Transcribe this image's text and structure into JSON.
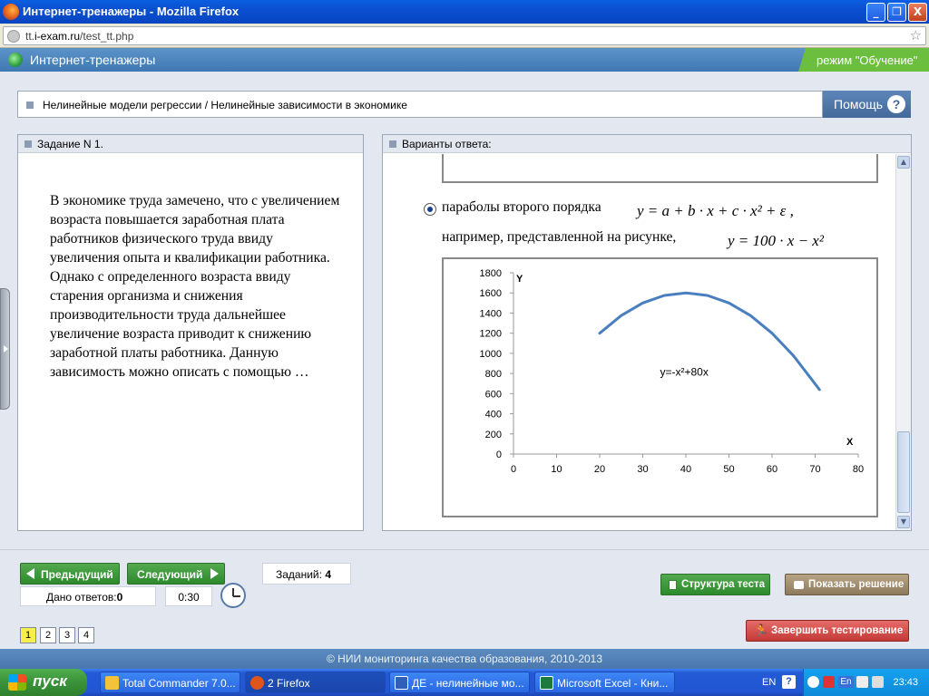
{
  "window": {
    "title": "Интернет-тренажеры - Mozilla Firefox",
    "min": "_",
    "max": "❐",
    "close": "X"
  },
  "browser": {
    "url_prefix": "tt.",
    "url_domain": "i-exam.ru",
    "url_path": "/test_tt.php",
    "star_icon": "star-icon"
  },
  "app": {
    "brand": "Интернет-тренажеры",
    "mode": "режим \"Обучение\""
  },
  "breadcrumb": "Нелинейные модели регрессии / Нелинейные зависимости в экономике",
  "help": {
    "label": "Помощь",
    "icon": "?"
  },
  "task": {
    "header": "Задание N 1.",
    "text": "В экономике труда замечено, что с увеличением возраста повышается заработная плата работников физического труда ввиду увеличения опыта и квалификации работника. Однако с определенного возраста ввиду старения организма и снижения производительности труда дальнейшее увеличение возраста приводит к снижению заработной платы работника. Данную зависимость можно описать с помощью …"
  },
  "answers": {
    "header": "Варианты ответа:",
    "option_line1": "параболы второго порядка",
    "option_line2": "например, представленной на рисунке,",
    "formula1": "y = a + b · x + c · x² + ε ,",
    "formula2": "y = 100 · x − x²"
  },
  "chart_data": {
    "type": "line",
    "xlabel": "X",
    "ylabel": "Y",
    "xlim": [
      0,
      80
    ],
    "ylim": [
      0,
      1800
    ],
    "xticks": [
      0,
      10,
      20,
      30,
      40,
      50,
      60,
      70,
      80
    ],
    "yticks": [
      0,
      200,
      400,
      600,
      800,
      1000,
      1200,
      1400,
      1600,
      1800
    ],
    "annotation": "y=-x²+80x",
    "series": [
      {
        "x": [
          20,
          25,
          30,
          35,
          40,
          45,
          50,
          55,
          60,
          65,
          71
        ],
        "y": [
          1200,
          1375,
          1500,
          1575,
          1600,
          1575,
          1500,
          1375,
          1200,
          975,
          640
        ],
        "color": "#4a7fbf"
      }
    ]
  },
  "controls": {
    "prev": "Предыдущий",
    "next": "Следующий",
    "answered_label": "Дано ответов:",
    "answered_value": "0",
    "timer": "0:30",
    "tasks_label": "Заданий:",
    "tasks_value": "4",
    "structure": "Структура теста",
    "solution": "Показать решение",
    "finish": "Завершить тестирование",
    "pages": [
      "1",
      "2",
      "3",
      "4"
    ]
  },
  "footer": "© НИИ мониторинга качества образования, 2010-2013",
  "taskbar": {
    "start": "пуск",
    "tasks": [
      "Total Commander 7.0...",
      "2 Firefox",
      "ДЕ - нелинейные мо...",
      "Microsoft Excel - Кни..."
    ],
    "lang": "EN",
    "tray_lang": "En",
    "time": "23:43"
  }
}
